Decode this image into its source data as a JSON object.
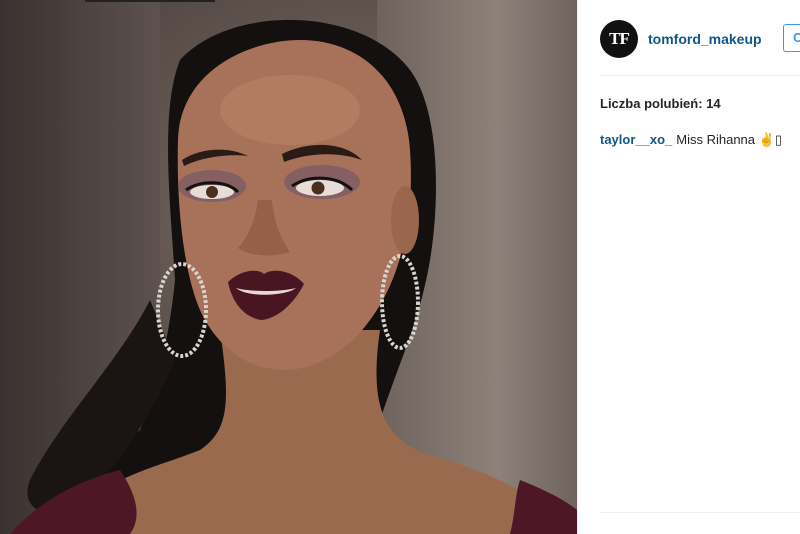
{
  "post": {
    "photo_alt": "",
    "author": {
      "avatar_text": "TF",
      "username": "tomford_makeup"
    },
    "follow_label": "O",
    "likes_text": "Liczba polubień: 14",
    "comments": [
      {
        "user": "taylor__xo_",
        "text": "Miss Rihanna ✌▯"
      }
    ]
  },
  "colors": {
    "username_blue": "#125688",
    "follow_blue": "#3897f0",
    "divider": "#efefef",
    "lip_color": "#4a1522"
  },
  "icons": {
    "avatar": "tom-ford-logo-icon"
  }
}
